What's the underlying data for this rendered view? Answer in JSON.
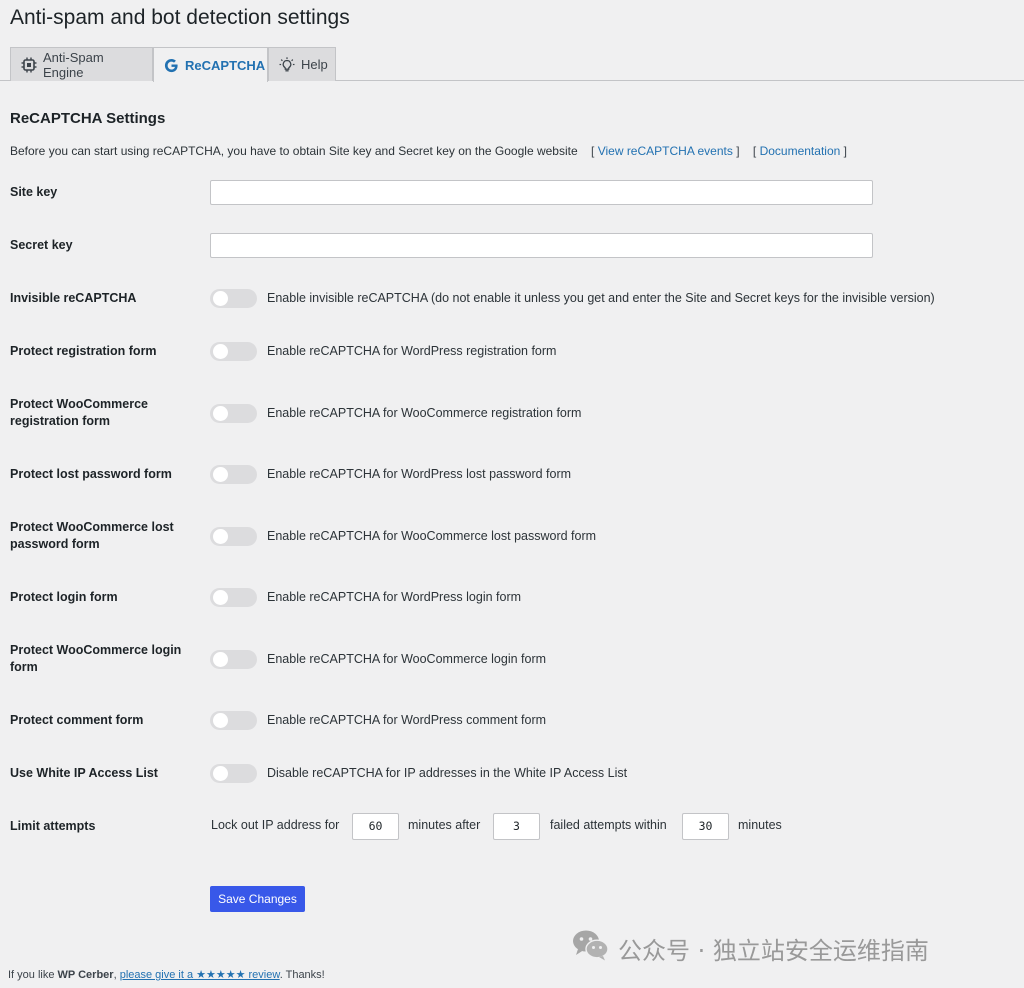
{
  "page": {
    "title": "Anti-spam and bot detection settings"
  },
  "tabs": [
    {
      "label": "Anti-Spam Engine",
      "icon": "chip-icon"
    },
    {
      "label": "ReCAPTCHA",
      "icon": "google-g-icon",
      "active": true
    },
    {
      "label": "Help",
      "icon": "lightbulb-icon"
    }
  ],
  "section": {
    "title": "ReCAPTCHA Settings",
    "intro": "Before you can start using reCAPTCHA, you have to obtain Site key and Secret key on the Google website",
    "link_events": "View reCAPTCHA events",
    "link_docs": "Documentation",
    "bracket_open": "[",
    "bracket_close": "]"
  },
  "fields": {
    "site_key": {
      "label": "Site key",
      "value": ""
    },
    "secret_key": {
      "label": "Secret key",
      "value": ""
    }
  },
  "toggles": [
    {
      "label": "Invisible reCAPTCHA",
      "text": "Enable invisible reCAPTCHA (do not enable it unless you get and enter the Site and Secret keys for the invisible version)",
      "on": false
    },
    {
      "label": "Protect registration form",
      "text": "Enable reCAPTCHA for WordPress registration form",
      "on": false
    },
    {
      "label": "Protect WooCommerce registration form",
      "text": "Enable reCAPTCHA for WooCommerce registration form",
      "on": false
    },
    {
      "label": "Protect lost password form",
      "text": "Enable reCAPTCHA for WordPress lost password form",
      "on": false
    },
    {
      "label": "Protect WooCommerce lost password form",
      "text": "Enable reCAPTCHA for WooCommerce lost password form",
      "on": false
    },
    {
      "label": "Protect login form",
      "text": "Enable reCAPTCHA for WordPress login form",
      "on": false
    },
    {
      "label": "Protect WooCommerce login form",
      "text": "Enable reCAPTCHA for WooCommerce login form",
      "on": false
    },
    {
      "label": "Protect comment form",
      "text": "Enable reCAPTCHA for WordPress comment form",
      "on": false
    },
    {
      "label": "Use White IP Access List",
      "text": "Disable reCAPTCHA for IP addresses in the White IP Access List",
      "on": false
    }
  ],
  "limit": {
    "label": "Limit attempts",
    "text1": "Lock out IP address for",
    "minutes": "60",
    "text2": "minutes after",
    "attempts": "3",
    "text3": "failed attempts within",
    "within": "30",
    "text4": "minutes"
  },
  "save_button": "Save Changes",
  "watermark": "公众号 · 独立站安全运维指南",
  "footer": {
    "prefix": "If you like",
    "brand": "WP Cerber",
    "comma": ",",
    "link": "please give it a ★★★★★ review",
    "suffix": ". Thanks!"
  }
}
